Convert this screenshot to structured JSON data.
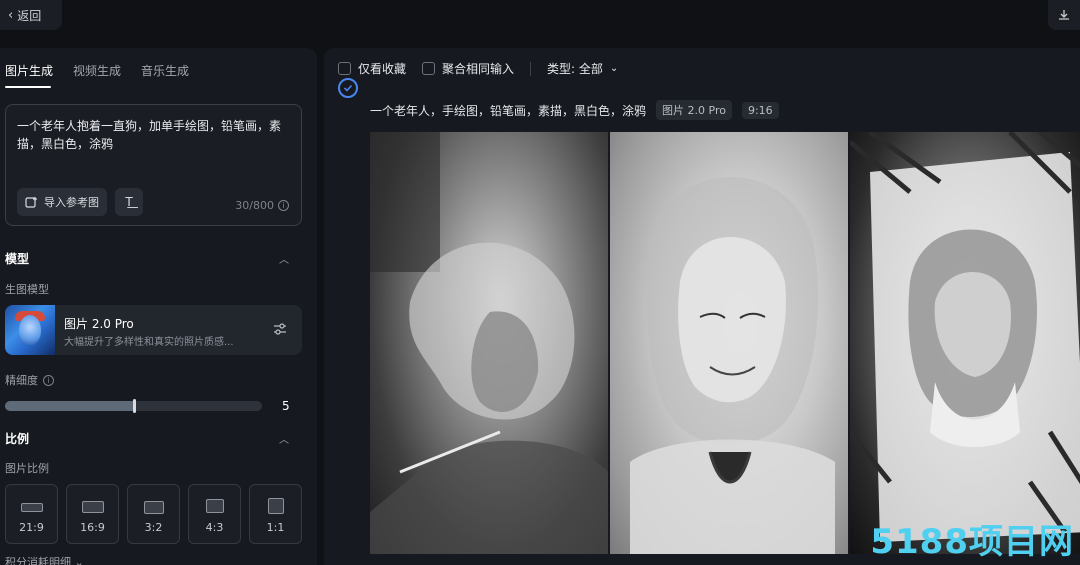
{
  "header": {
    "back_label": "返回"
  },
  "left": {
    "tabs": [
      {
        "label": "图片生成",
        "active": true
      },
      {
        "label": "视频生成",
        "active": false
      },
      {
        "label": "音乐生成",
        "active": false
      }
    ],
    "prompt": {
      "text": "一个老年人抱着一直狗，加单手绘图，铅笔画，素描，黑白色，涂鸦",
      "import_label": "导入参考图",
      "count": "30/800"
    },
    "model_section": {
      "title": "模型",
      "sub_label": "生图模型",
      "model_name": "图片 2.0 Pro",
      "model_desc": "大幅提升了多样性和真实的照片质感..."
    },
    "detail": {
      "label": "精细度",
      "value": "5",
      "level_fraction": 0.5
    },
    "ratio_section": {
      "title": "比例",
      "sub_label": "图片比例",
      "ratios": [
        {
          "label": "21:9"
        },
        {
          "label": "16:9"
        },
        {
          "label": "3:2"
        },
        {
          "label": "4:3"
        },
        {
          "label": "1:1"
        }
      ]
    },
    "points_label": "积分消耗明细"
  },
  "right": {
    "filters": {
      "favorites_label": "仅看收藏",
      "merge_label": "聚合相同输入",
      "type_label": "类型: 全部"
    },
    "record": {
      "prompt": "一个老年人，手绘图，铅笔画，素描，黑白色，涂鸦",
      "model_tag": "图片 2.0 Pro",
      "ratio_tag": "9:16"
    }
  },
  "watermark": "5188项目网",
  "colors": {
    "accent": "#4a86f0",
    "panel": "#16191f",
    "background": "#0f1115"
  }
}
